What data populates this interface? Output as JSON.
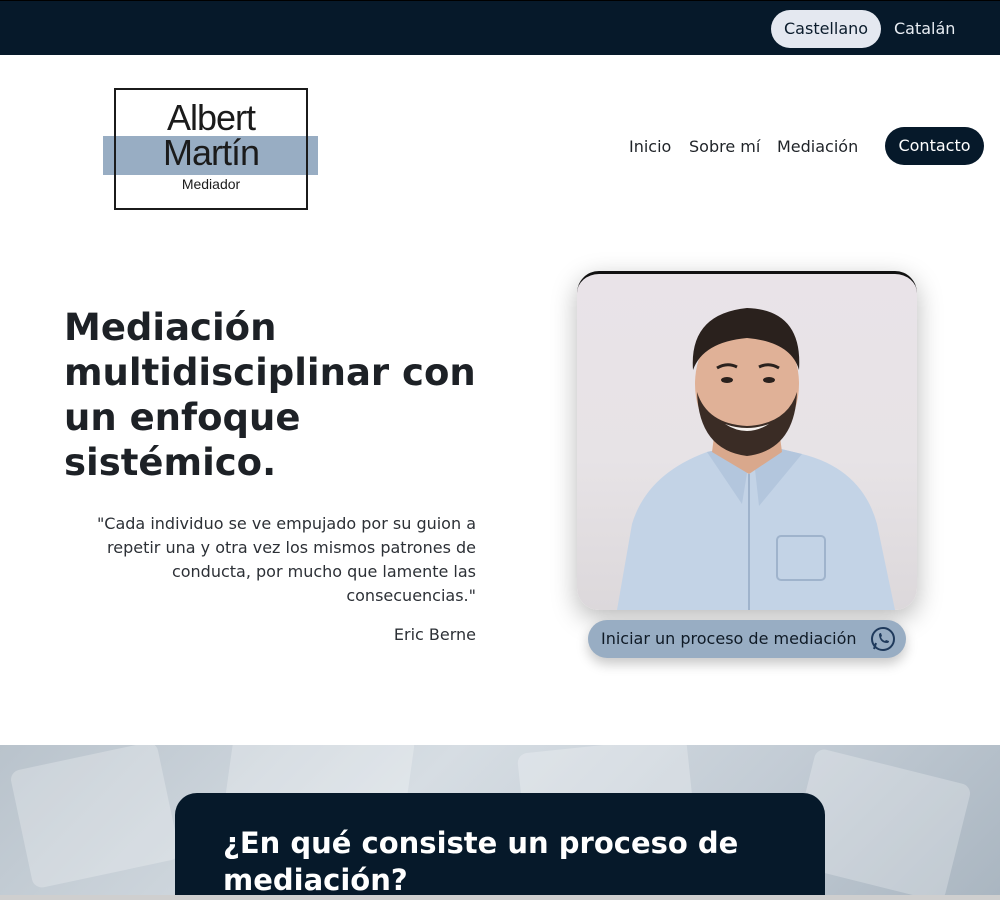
{
  "languages": {
    "active": "Castellano",
    "other": "Catalán"
  },
  "logo": {
    "first_name": "Albert",
    "last_name": "Martín",
    "subtitle": "Mediador"
  },
  "nav": {
    "home": "Inicio",
    "about": "Sobre mí",
    "mediation": "Mediación",
    "contact": "Contacto"
  },
  "hero": {
    "title": "Mediación multidisciplinar con un enfoque sistémico.",
    "quote": "\"Cada individuo se ve empujado por su guion a repetir una y otra vez los mismos patrones de conducta, por mucho que lamente las consecuencias.\"",
    "author": "Eric Berne",
    "cta": "Iniciar un proceso de mediación",
    "cta_icon": "whatsapp-icon"
  },
  "section": {
    "title": "¿En qué consiste un proceso de mediación?"
  },
  "colors": {
    "navy": "#06192a",
    "accent": "#98adc3",
    "light": "#e4e8f0"
  }
}
